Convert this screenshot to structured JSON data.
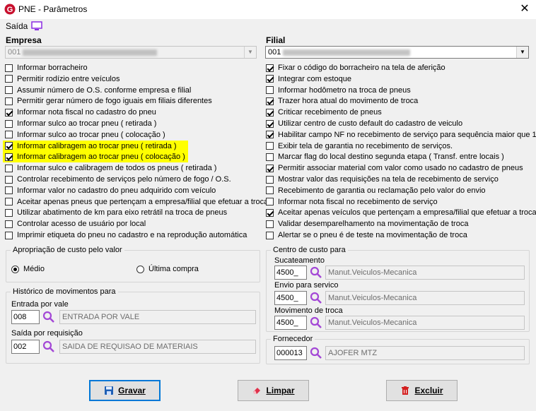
{
  "window": {
    "title": "PNE - Parâmetros",
    "close_label": "✕"
  },
  "menu": {
    "saida": "Saída"
  },
  "empresa": {
    "label": "Empresa",
    "value": "001"
  },
  "filial": {
    "label": "Filial",
    "value": "001"
  },
  "left_checks": [
    {
      "label": "Informar borracheiro",
      "checked": false
    },
    {
      "label": "Permitir rodízio entre veículos",
      "checked": false
    },
    {
      "label": "Assumir número de O.S. conforme empresa e filial",
      "checked": false
    },
    {
      "label": "Permitir gerar número de fogo iguais em filiais diferentes",
      "checked": false
    },
    {
      "label": "Informar nota fiscal no cadastro do pneu",
      "checked": true
    },
    {
      "label": "Informar sulco ao trocar pneu ( retirada )",
      "checked": false
    },
    {
      "label": "Informar sulco ao trocar pneu ( colocação )",
      "checked": false
    },
    {
      "label": "Informar calibragem ao trocar pneu ( retirada )",
      "checked": true,
      "highlight": true
    },
    {
      "label": "Informar calibragem ao trocar pneu ( colocação )",
      "checked": true,
      "highlight": true
    },
    {
      "label": "Informar sulco e calibragem de todos os pneus ( retirada )",
      "checked": false
    },
    {
      "label": "Controlar recebimento de serviços pelo número de fogo / O.S.",
      "checked": false
    },
    {
      "label": "Informar valor no cadastro do pneu adquirido com veículo",
      "checked": false
    },
    {
      "label": "Aceitar apenas pneus que pertençam a empresa/filial que efetuar a troca",
      "checked": false
    },
    {
      "label": "Utilizar abatimento de km para eixo retrátil na troca de pneus",
      "checked": false
    },
    {
      "label": "Controlar acesso de usuário por local",
      "checked": false
    },
    {
      "label": "Imprimir etiqueta do pneu no cadastro e na reprodução automática",
      "checked": false
    }
  ],
  "right_checks": [
    {
      "label": "Fixar o código do borracheiro na tela de aferição",
      "checked": true
    },
    {
      "label": "Integrar com estoque",
      "checked": true
    },
    {
      "label": "Informar hodômetro na troca de pneus",
      "checked": false
    },
    {
      "label": "Trazer hora atual do movimento de troca",
      "checked": true
    },
    {
      "label": "Criticar recebimento de pneus",
      "checked": true
    },
    {
      "label": "Utilizar centro de custo default do cadastro de veiculo",
      "checked": true
    },
    {
      "label": "Habilitar campo NF no recebimento de serviço para sequência maior que 1",
      "checked": true
    },
    {
      "label": "Exibir tela de garantia no recebimento de serviços.",
      "checked": false
    },
    {
      "label": "Marcar flag do local destino segunda etapa ( Transf. entre locais )",
      "checked": false
    },
    {
      "label": "Permitir associar material com valor como usado no cadastro de pneus",
      "checked": true
    },
    {
      "label": "Mostrar valor das requisições na tela de recebimento de serviço",
      "checked": false
    },
    {
      "label": "Recebimento de garantia ou reclamação pelo valor do envio",
      "checked": false
    },
    {
      "label": "Informar nota fiscal no recebimento de serviço",
      "checked": false
    },
    {
      "label": "Aceitar apenas veículos que pertençam a empresa/filial que efetuar a troca",
      "checked": true
    },
    {
      "label": "Validar desemparelhamento na movimentação de troca",
      "checked": false
    },
    {
      "label": "Alertar se o pneu é de teste na movimentação de troca",
      "checked": false
    }
  ],
  "apropriacao": {
    "legend": "Apropriação de custo pelo valor",
    "opt1": "Médio",
    "opt2": "Última compra",
    "selected": "Médio"
  },
  "historico": {
    "legend": "Histórico de movimentos para",
    "entrada_label": "Entrada por vale",
    "entrada_code": "008",
    "entrada_desc": "ENTRADA POR VALE",
    "saida_label": "Saída por requisição",
    "saida_code": "002",
    "saida_desc": "SAIDA DE REQUISAO DE MATERIAIS"
  },
  "centro": {
    "legend": "Centro de custo para",
    "suc_label": "Sucateamento",
    "suc_code": "4500_",
    "suc_desc": "Manut.Veiculos-Mecanica",
    "env_label": "Envio para servico",
    "env_code": "4500_",
    "env_desc": "Manut.Veiculos-Mecanica",
    "mov_label": "Movimento de troca",
    "mov_code": "4500_",
    "mov_desc": "Manut.Veiculos-Mecanica"
  },
  "fornecedor": {
    "legend": "Fornecedor",
    "code": "000013",
    "desc": "AJOFER MTZ"
  },
  "buttons": {
    "gravar": "Gravar",
    "limpar": "Limpar",
    "excluir": "Excluir"
  },
  "colors": {
    "highlight": "#ffff00",
    "accent": "#0078d7",
    "search_icon": "#a347d6",
    "excluir_icon": "#d32020"
  }
}
